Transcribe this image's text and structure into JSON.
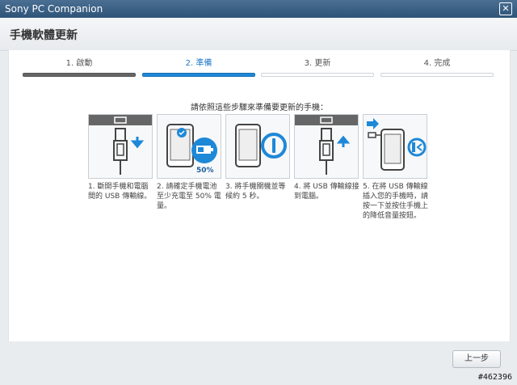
{
  "window": {
    "title": "Sony PC Companion",
    "close_glyph": "✕"
  },
  "header": {
    "title": "手機軟體更新"
  },
  "steps": [
    {
      "label": "1. 啟動",
      "state": "done"
    },
    {
      "label": "2. 準備",
      "state": "active"
    },
    {
      "label": "3. 更新",
      "state": "pending"
    },
    {
      "label": "4. 完成",
      "state": "pending"
    }
  ],
  "instructions": "請依照這些步驟來準備要更新的手機：",
  "cards": [
    {
      "icon": "usb-unplug-icon",
      "text": "1. 斷開手機和電腦間的 USB 傳輸線。"
    },
    {
      "icon": "battery-charge-icon",
      "badge": "50%",
      "text": "2. 請確定手機電池至少充電至 50% 電量。"
    },
    {
      "icon": "power-off-icon",
      "text": "3. 將手機關機並等候約 5 秒。"
    },
    {
      "icon": "usb-plug-icon",
      "text": "4. 將 USB 傳輸線接到電腦。"
    },
    {
      "icon": "phone-connect-volume-icon",
      "text": "5. 在將 USB 傳輸線插入您的手機時，請按一下並按住手機上的降低音量按鈕。"
    }
  ],
  "footer": {
    "prev_label": "上一步"
  },
  "watermark": "#462396",
  "colors": {
    "accent": "#1e88d8",
    "title_bar": "#2e5478"
  }
}
